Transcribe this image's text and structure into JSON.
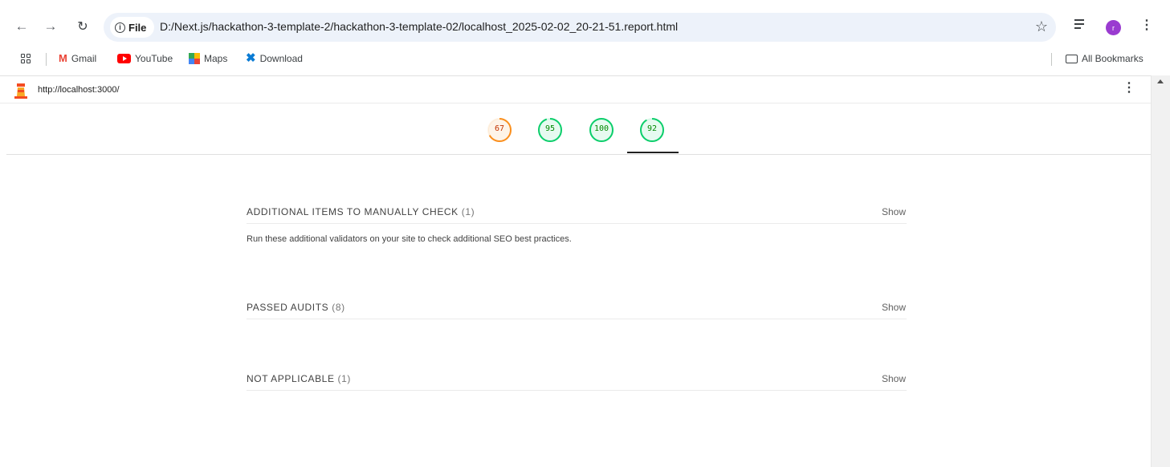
{
  "browser": {
    "info_chip_label": "File",
    "address": "D:/Next.js/hackathon-3-template-2/hackathon-3-template-02/localhost_2025-02-02_20-21-51.report.html",
    "avatar_initial": "r",
    "bookmarks": [
      {
        "label": "Gmail",
        "icon": "gmail-icon"
      },
      {
        "label": "YouTube",
        "icon": "youtube-icon"
      },
      {
        "label": "Maps",
        "icon": "maps-icon"
      },
      {
        "label": "Download",
        "icon": "vscode-icon"
      }
    ],
    "all_bookmarks_label": "All Bookmarks"
  },
  "report": {
    "url": "http://localhost:3000/",
    "scores": [
      {
        "label": "67",
        "value": 67,
        "color": "#fa8f1d"
      },
      {
        "label": "95",
        "value": 95,
        "color": "#0cce6b"
      },
      {
        "label": "100",
        "value": 100,
        "color": "#0cce6b"
      },
      {
        "label": "92",
        "value": 92,
        "color": "#0cce6b"
      }
    ],
    "groups": [
      {
        "title": "ADDITIONAL ITEMS TO MANUALLY CHECK",
        "count": "(1)",
        "action": "Show",
        "description": "Run these additional validators on your site to check additional SEO best practices."
      },
      {
        "title": "PASSED AUDITS",
        "count": "(8)",
        "action": "Show"
      },
      {
        "title": "NOT APPLICABLE",
        "count": "(1)",
        "action": "Show"
      }
    ]
  }
}
